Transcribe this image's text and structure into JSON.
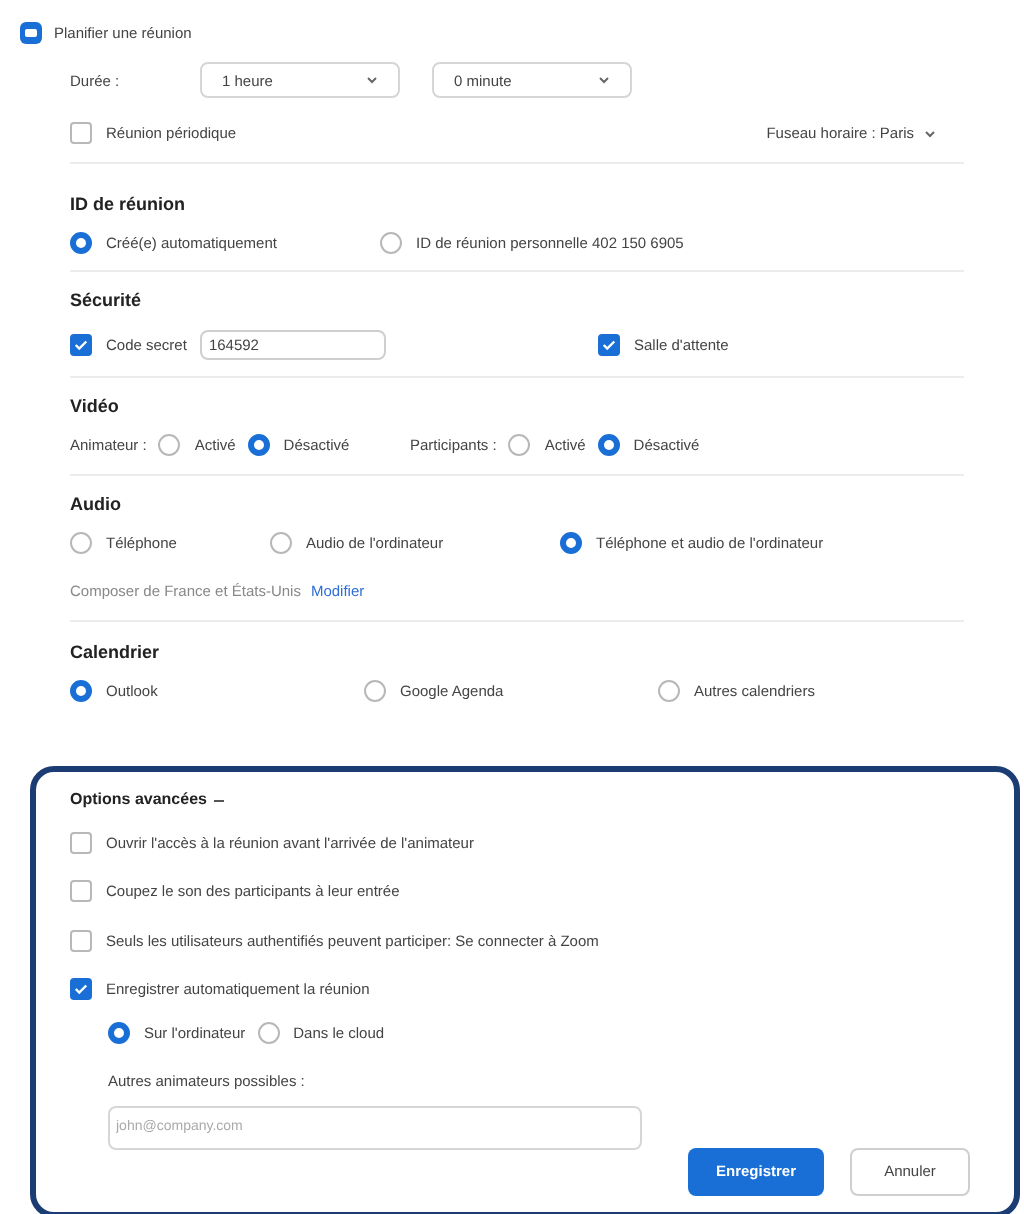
{
  "header": {
    "title": "Planifier une réunion"
  },
  "duration": {
    "label": "Durée :",
    "hours": "1 heure",
    "minutes": "0 minute"
  },
  "recurring": {
    "label": "Réunion périodique",
    "checked": false
  },
  "timezone": {
    "label": "Fuseau horaire : Paris"
  },
  "meeting_id": {
    "title": "ID de réunion",
    "options": [
      {
        "label": "Créé(e) automatiquement",
        "selected": true
      },
      {
        "label": "ID de réunion personnelle 402 150 6905",
        "selected": false
      }
    ]
  },
  "security": {
    "title": "Sécurité",
    "passcode": {
      "label": "Code secret",
      "checked": true,
      "value": "164592"
    },
    "waiting_room": {
      "label": "Salle d'attente",
      "checked": true
    }
  },
  "video": {
    "title": "Vidéo",
    "groups": [
      {
        "label": "Animateur :",
        "options": [
          {
            "label": "Activé",
            "selected": false
          },
          {
            "label": "Désactivé",
            "selected": true
          }
        ]
      },
      {
        "label": "Participants :",
        "options": [
          {
            "label": "Activé",
            "selected": false
          },
          {
            "label": "Désactivé",
            "selected": true
          }
        ]
      }
    ]
  },
  "audio": {
    "title": "Audio",
    "options": [
      {
        "label": "Téléphone",
        "selected": false
      },
      {
        "label": "Audio de l'ordinateur",
        "selected": false
      },
      {
        "label": "Téléphone et audio de l'ordinateur",
        "selected": true
      }
    ],
    "dial_in": "Composer de France et États-Unis",
    "edit_link": "Modifier"
  },
  "calendar": {
    "title": "Calendrier",
    "options": [
      {
        "label": "Outlook",
        "selected": true
      },
      {
        "label": "Google Agenda",
        "selected": false
      },
      {
        "label": "Autres calendriers",
        "selected": false
      }
    ]
  },
  "advanced": {
    "title": "Options avancées",
    "expanded": true,
    "options": [
      {
        "label": "Ouvrir l'accès à la réunion avant l'arrivée de l'animateur",
        "checked": false
      },
      {
        "label": "Coupez le son des participants à leur entrée",
        "checked": false
      },
      {
        "label": "Seuls les utilisateurs authentifiés peuvent participer: Se connecter à Zoom",
        "checked": false
      },
      {
        "label": "Enregistrer automatiquement la réunion",
        "checked": true
      }
    ],
    "record_location": [
      {
        "label": "Sur l'ordinateur",
        "selected": true
      },
      {
        "label": "Dans le cloud",
        "selected": false
      }
    ],
    "alt_hosts": {
      "label": "Autres animateurs possibles :",
      "placeholder": "john@company.com"
    }
  },
  "buttons": [
    {
      "label": "Enregistrer",
      "kind": "primary"
    },
    {
      "label": "Annuler",
      "kind": "secondary"
    }
  ]
}
